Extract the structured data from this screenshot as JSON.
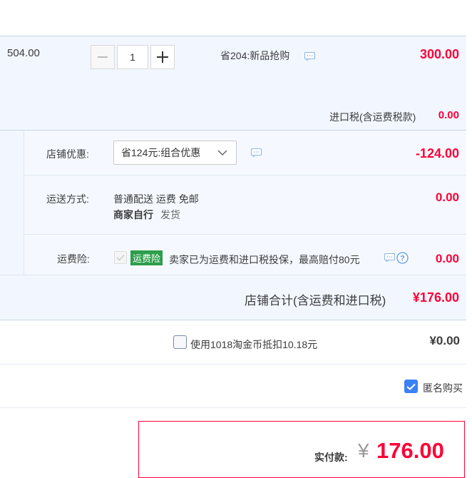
{
  "item": {
    "unit_price": "504.00",
    "quantity": "1",
    "promo_text": "省204:新品抢购",
    "subtotal": "300.00",
    "tax_label": "进口税(含运费税款)",
    "tax_value": "0.00"
  },
  "store": {
    "discount_label": "店铺优惠:",
    "discount_select": "省124元:组合优惠",
    "discount_value": "-124.00",
    "shipping_label": "运送方式:",
    "shipping_method": "普通配送 运费 免邮",
    "shipping_by": "商家自行",
    "shipping_action": "发货",
    "shipping_value": "0.00",
    "insurance_label": "运费险:",
    "insurance_badge": "运费险",
    "insurance_text": "卖家已为运费和进口税投保，最高赔付80元",
    "insurance_value": "0.00",
    "total_label": "店铺合计(含运费和进口税)",
    "total_value": "¥176.00"
  },
  "coins": {
    "label": "使用1018淘金币抵扣10.18元",
    "value": "¥0.00"
  },
  "anonymous": {
    "label": "匿名购买"
  },
  "payment": {
    "label": "实付款:",
    "currency": "¥",
    "amount": "176.00"
  },
  "colors": {
    "price_red": "#ff0036",
    "panel_blue": "#f2f7ff",
    "badge_green": "#2d9e4b",
    "check_blue": "#3a80f6"
  }
}
